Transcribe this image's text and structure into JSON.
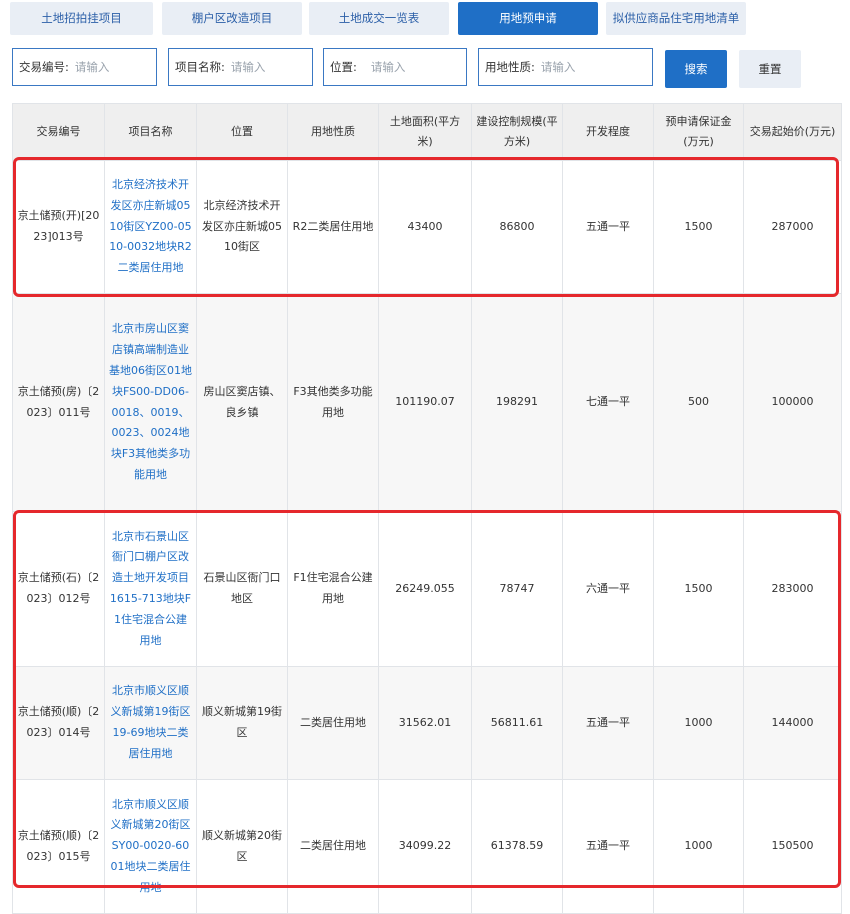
{
  "tabs": [
    {
      "label": "土地招拍挂项目",
      "active": false
    },
    {
      "label": "棚户区改造项目",
      "active": false
    },
    {
      "label": "土地成交一览表",
      "active": false
    },
    {
      "label": "用地预申请",
      "active": true
    },
    {
      "label": "拟供应商品住宅用地清单",
      "active": false
    }
  ],
  "filters": {
    "trade_no_label": "交易编号:",
    "project_name_label": "项目名称:",
    "location_label": "位置:",
    "land_use_label": "用地性质:",
    "placeholder": "请输入",
    "search_label": "搜索",
    "reset_label": "重置"
  },
  "table": {
    "headers": [
      "交易编号",
      "项目名称",
      "位置",
      "用地性质",
      "土地面积(平方米)",
      "建设控制规模(平方米)",
      "开发程度",
      "预申请保证金(万元)",
      "交易起始价(万元)"
    ],
    "rows": [
      {
        "trade_no": "京土储预(开)[2023]013号",
        "project": "北京经济技术开发区亦庄新城0510街区YZ00-0510-0032地块R2二类居住用地",
        "location": "北京经济技术开发区亦庄新城0510街区",
        "land_use": "R2二类居住用地",
        "area": "43400",
        "scale": "86800",
        "development": "五通一平",
        "deposit": "1500",
        "start_price": "287000"
      },
      {
        "trade_no": "京土储预(房)〔2023〕011号",
        "project": "北京市房山区窦店镇高端制造业基地06街区01地块FS00-DD06-0018、0019、0023、0024地块F3其他类多功能用地",
        "location": "房山区窦店镇、良乡镇",
        "land_use": "F3其他类多功能用地",
        "area": "101190.07",
        "scale": "198291",
        "development": "七通一平",
        "deposit": "500",
        "start_price": "100000"
      },
      {
        "trade_no": "京土储预(石)〔2023〕012号",
        "project": "北京市石景山区衙门口棚户区改造土地开发项目1615-713地块F1住宅混合公建用地",
        "location": "石景山区衙门口地区",
        "land_use": "F1住宅混合公建用地",
        "area": "26249.055",
        "scale": "78747",
        "development": "六通一平",
        "deposit": "1500",
        "start_price": "283000"
      },
      {
        "trade_no": "京土储预(顺)〔2023〕014号",
        "project": "北京市顺义区顺义新城第19街区19-69地块二类居住用地",
        "location": "顺义新城第19街区",
        "land_use": "二类居住用地",
        "area": "31562.01",
        "scale": "56811.61",
        "development": "五通一平",
        "deposit": "1000",
        "start_price": "144000"
      },
      {
        "trade_no": "京土储预(顺)〔2023〕015号",
        "project": "北京市顺义区顺义新城第20街区SY00-0020-6001地块二类居住用地",
        "location": "顺义新城第20街区",
        "land_use": "二类居住用地",
        "area": "34099.22",
        "scale": "61378.59",
        "development": "五通一平",
        "deposit": "1000",
        "start_price": "150500"
      }
    ]
  },
  "highlight_color": "#e5282c",
  "accent_color": "#1f6fc6"
}
